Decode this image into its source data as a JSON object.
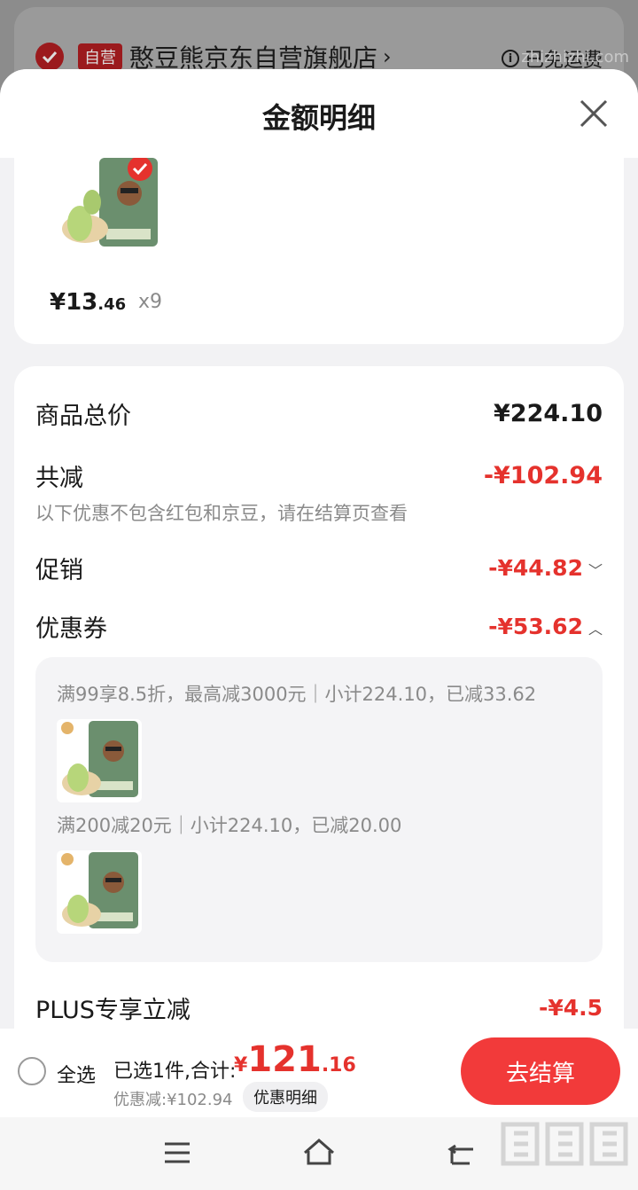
{
  "store": {
    "badge": "自营",
    "name": "憨豆熊京东自营旗舰店",
    "chevron": "›",
    "shipping": "已免运费"
  },
  "sheet": {
    "title": "金额明细"
  },
  "product": {
    "price_int": "¥13",
    "price_dec": ".46",
    "qty": "x9"
  },
  "details": {
    "total_label": "商品总价",
    "total_value": "¥224.10",
    "reduce_label": "共减",
    "reduce_value": "-¥102.94",
    "note": "以下优惠不包含红包和京豆，请在结算页查看",
    "promo_label": "促销",
    "promo_value": "-¥44.82",
    "coupon_label": "优惠券",
    "coupon_value": "-¥53.62",
    "coupons": [
      "满99享8.5折，最高减3000元｜小计224.10，已减33.62",
      "满200减20元｜小计224.10，已减20.00"
    ],
    "plus_label": "PLUS专享立减",
    "plus_value": "-¥4.5"
  },
  "footer": {
    "select_all": "全选",
    "selected_text": "已选1件,合计:",
    "amount_currency": "¥",
    "amount_int": "121",
    "amount_dec": ".16",
    "discount_text": "优惠减:¥102.94",
    "discount_btn": "优惠明细",
    "checkout": "去结算"
  },
  "watermark": {
    "text": "zhizhizhi.com"
  },
  "colors": {
    "accent_red": "#e5322d",
    "checkout_red": "#f23a3a"
  }
}
